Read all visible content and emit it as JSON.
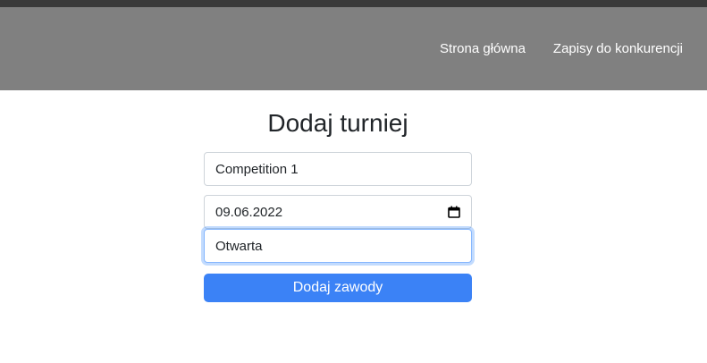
{
  "navbar": {
    "links": [
      {
        "label": "Strona główna"
      },
      {
        "label": "Zapisy do konkurencji"
      }
    ]
  },
  "page": {
    "title": "Dodaj turniej"
  },
  "form": {
    "name_value": "Competition 1",
    "date_value": "09.06.2022",
    "type_value": "Otwarta",
    "submit_label": "Dodaj zawody"
  },
  "colors": {
    "navbar_bg": "#808080",
    "topbar": "#3a3a3a",
    "button_bg": "#3b82f6",
    "focus_border": "#86b7fe"
  },
  "icons": {
    "date_picker": "calendar-icon"
  }
}
